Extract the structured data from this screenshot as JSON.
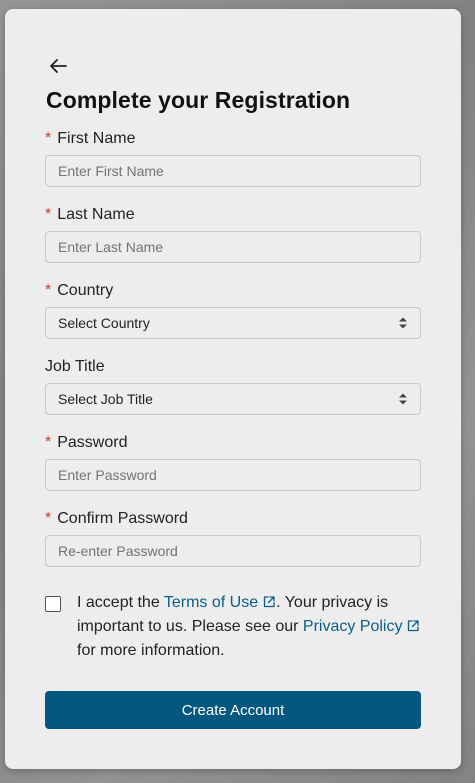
{
  "form": {
    "title": "Complete your Registration",
    "required_marker": "*",
    "first_name": {
      "label": "First Name",
      "placeholder": "Enter First Name"
    },
    "last_name": {
      "label": "Last Name",
      "placeholder": "Enter Last Name"
    },
    "country": {
      "label": "Country",
      "selected": "Select Country"
    },
    "job_title": {
      "label": "Job Title",
      "selected": "Select Job Title"
    },
    "password": {
      "label": "Password",
      "placeholder": "Enter Password"
    },
    "confirm_password": {
      "label": "Confirm Password",
      "placeholder": "Re-enter Password"
    },
    "terms": {
      "prefix": "I accept the ",
      "terms_link": "Terms of Use",
      "middle": ". Your privacy is important to us. Please see our ",
      "privacy_link": "Privacy Policy",
      "suffix": " for more information.",
      "checked": false
    },
    "submit_label": "Create Account"
  },
  "icons": {
    "back": "arrow-left-icon",
    "select_caret": "sort-caret-icon",
    "external": "external-link-icon"
  },
  "colors": {
    "primary_button": "#04577f",
    "link": "#0b5d8a",
    "required": "#c23934",
    "card_background": "#ededed"
  }
}
